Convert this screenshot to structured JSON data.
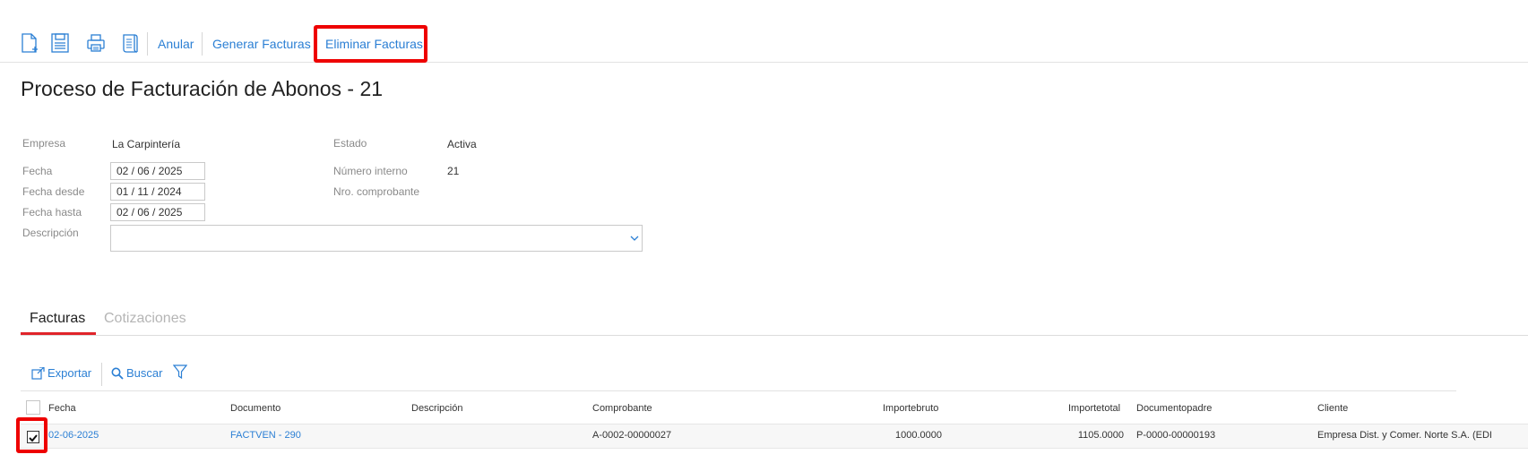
{
  "toolbar": {
    "icons": [
      "new-document-icon",
      "save-icon",
      "print-icon",
      "report-icon"
    ],
    "anular_label": "Anular",
    "generar_label": "Generar Facturas",
    "eliminar_label": "Eliminar Facturas",
    "link_color": "#2b7fd4",
    "highlight_color": "#ee0000"
  },
  "page": {
    "title": "Proceso de Facturación de Abonos - 21"
  },
  "form": {
    "empresa_label": "Empresa",
    "empresa_value": "La Carpintería",
    "fecha_label": "Fecha",
    "fecha_value": "02 / 06 /  2025",
    "fecha_desde_label": "Fecha desde",
    "fecha_desde_value": "01 / 11 /  2024",
    "fecha_hasta_label": "Fecha hasta",
    "fecha_hasta_value": "02 / 06 /  2025",
    "descripcion_label": "Descripción",
    "descripcion_value": "",
    "estado_label": "Estado",
    "estado_value": "Activa",
    "numero_interno_label": "Número interno",
    "numero_interno_value": "21",
    "nro_comprobante_label": "Nro. comprobante",
    "nro_comprobante_value": ""
  },
  "tabs": [
    {
      "label": "Facturas",
      "active": true
    },
    {
      "label": "Cotizaciones",
      "active": false
    }
  ],
  "grid_toolbar": {
    "exportar_label": "Exportar",
    "buscar_label": "Buscar"
  },
  "table": {
    "headers": [
      "Fecha",
      "Documento",
      "Descripción",
      "Comprobante",
      "Importebruto",
      "Importetotal",
      "Documentopadre",
      "Cliente"
    ],
    "rows": [
      {
        "checked": true,
        "fecha": "02-06-2025",
        "documento": "FACTVEN - 290",
        "descripcion": "",
        "comprobante": "A-0002-00000027",
        "importebruto": "1000.0000",
        "importetotal": "1105.0000",
        "documentopadre": "P-0000-00000193",
        "cliente": "Empresa Dist. y Comer. Norte S.A. (EDI"
      }
    ]
  }
}
